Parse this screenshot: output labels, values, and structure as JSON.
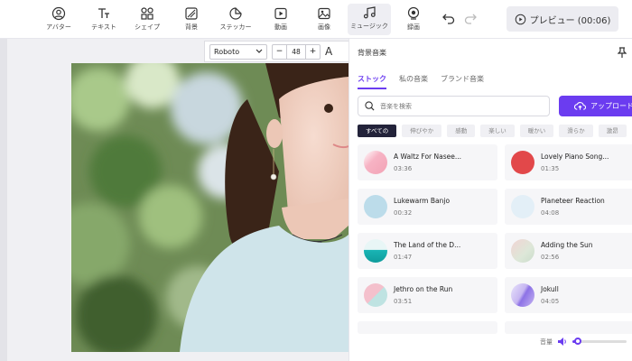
{
  "toolbar": {
    "tools": [
      {
        "label": "アバター",
        "icon": "avatar-icon"
      },
      {
        "label": "テキスト",
        "icon": "text-icon"
      },
      {
        "label": "シェイプ",
        "icon": "shapes-icon"
      },
      {
        "label": "背景",
        "icon": "background-icon"
      },
      {
        "label": "ステッカー",
        "icon": "sticker-icon"
      },
      {
        "label": "動画",
        "icon": "video-icon"
      },
      {
        "label": "画像",
        "icon": "image-icon"
      },
      {
        "label": "ミュージック",
        "icon": "music-icon"
      },
      {
        "label": "録画",
        "icon": "record-icon"
      }
    ],
    "active_tool": "ミュージック",
    "preview_label": "プレビュー (00:06)"
  },
  "text_toolbar": {
    "font": "Roboto",
    "size": "48",
    "minus": "−",
    "plus": "+",
    "text_tool_glyph": "A"
  },
  "music_panel": {
    "title": "背景音楽",
    "tabs": [
      "ストック",
      "私の音楽",
      "ブランド音楽"
    ],
    "active_tab": "ストック",
    "search_placeholder": "音楽を検索",
    "upload_label": "アップロード",
    "chips": [
      "すべての",
      "伸びやか",
      "感動",
      "楽しい",
      "暖かい",
      "滑らか",
      "激昂"
    ],
    "active_chip": "すべての",
    "tracks": [
      {
        "title": "A Waltz For Nasee...",
        "duration": "03:36",
        "color": "#f7b3c4"
      },
      {
        "title": "Lovely Piano Song...",
        "duration": "01:35",
        "color": "#e2484a"
      },
      {
        "title": "Lukewarm Banjo",
        "duration": "00:32",
        "color": "#bcdcea"
      },
      {
        "title": "Planeteer Reaction",
        "duration": "04:08",
        "color": "#e3eff7"
      },
      {
        "title": "The Land of the D...",
        "duration": "01:47",
        "color": "#19b5b5"
      },
      {
        "title": "Adding the Sun",
        "duration": "02:56",
        "color": "#dde7d8"
      },
      {
        "title": "Jethro on the Run",
        "duration": "03:51",
        "color": "#f4c0cc"
      },
      {
        "title": "Jokull",
        "duration": "04:05",
        "color": "#c6b6f1"
      }
    ],
    "volume_label": "音量",
    "volume_level": 0.1
  },
  "colors": {
    "accent": "#6b3cf0"
  }
}
